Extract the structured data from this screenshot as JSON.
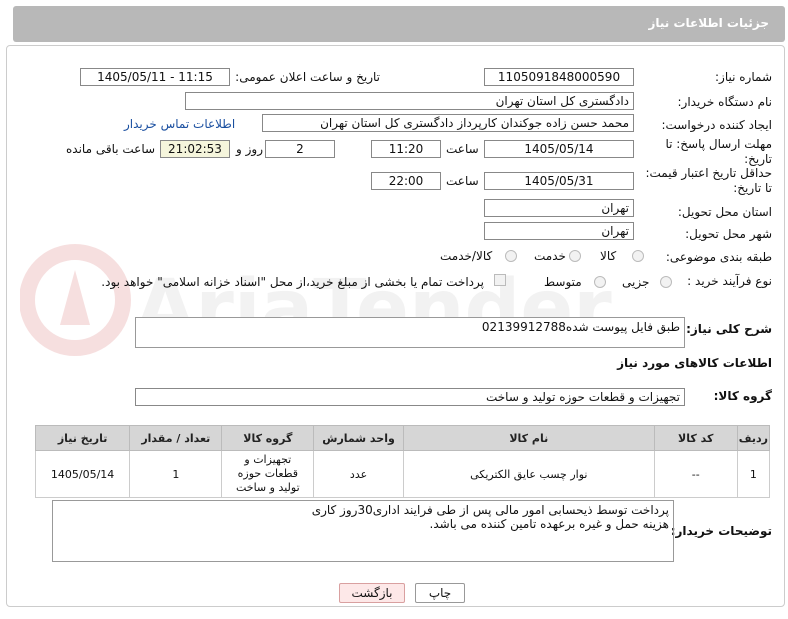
{
  "header": {
    "title": "جزئیات اطلاعات نیاز"
  },
  "fields": {
    "need_number_label": "شماره نیاز:",
    "need_number": "1105091848000590",
    "announce_label": "تاریخ و ساعت اعلان عمومی:",
    "announce_value": "1405/05/11 - 11:15",
    "buyer_org_label": "نام دستگاه خریدار:",
    "buyer_org": "دادگستری کل استان تهران",
    "requester_label": "ایجاد کننده درخواست:",
    "requester": "محمد حسن زاده جوکندان کارپرداز دادگستری کل استان تهران",
    "buyer_contact_link": "اطلاعات تماس خریدار",
    "deadline_label": "مهلت ارسال پاسخ: تا تاریخ:",
    "deadline_date": "1405/05/14",
    "time_word": "ساعت",
    "deadline_time": "11:20",
    "days_value": "2",
    "days_word": "روز و",
    "remaining_time": "21:02:53",
    "remaining_word": "ساعت باقی مانده",
    "price_validity_label": "حداقل تاریخ اعتبار قیمت: تا تاریخ:",
    "price_validity_date": "1405/05/31",
    "price_validity_time": "22:00",
    "delivery_province_label": "استان محل تحویل:",
    "delivery_province": "تهران",
    "delivery_city_label": "شهر محل تحویل:",
    "delivery_city": "تهران",
    "category_label": "طبقه بندی موضوعی:",
    "category_options": [
      "کالا",
      "خدمت",
      "کالا/خدمت"
    ],
    "purchase_type_label": "نوع فرآیند خرید :",
    "purchase_type_options": [
      "جزیی",
      "متوسط"
    ],
    "payment_note": "پرداخت تمام یا بخشی از مبلغ خرید،از محل \"اسناد خزانه اسلامی\" خواهد بود."
  },
  "description": {
    "label": "شرح کلی نیاز:",
    "value": "طبق فایل پیوست شده02139912788"
  },
  "goods_info": {
    "title": "اطلاعات کالاهای مورد نیاز",
    "group_label": "گروه کالا:",
    "group_value": "تجهیزات و قطعات حوزه تولید و ساخت"
  },
  "table": {
    "headers": [
      "ردیف",
      "کد کالا",
      "نام کالا",
      "واحد شمارش",
      "گروه کالا",
      "تعداد / مقدار",
      "تاریخ نیاز"
    ],
    "rows": [
      [
        "1",
        "--",
        "نوار چسب عایق الکتریکی",
        "عدد",
        "تجهیزات و قطعات حوزه تولید و ساخت",
        "1",
        "1405/05/14"
      ]
    ]
  },
  "buyer_notes": {
    "label": "توضیحات خریدار:",
    "line1": "پرداخت توسط ذیحسابی امور مالی پس از طی فرایند اداری30روز کاری",
    "line2": "هزینه حمل و غیره برعهده تامین کننده می باشد."
  },
  "buttons": {
    "print": "چاپ",
    "back": "بازگشت"
  },
  "watermark": {
    "text": "AriaTender.neT"
  }
}
